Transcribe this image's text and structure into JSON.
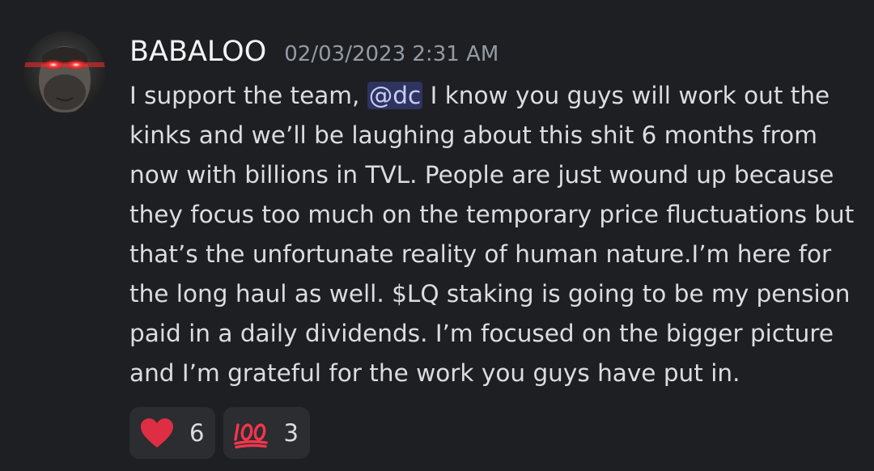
{
  "message": {
    "author": "BABALOO",
    "timestamp": "02/03/2023 2:31 AM",
    "text_before_mention": "I support the team, ",
    "mention": "@dc",
    "text_after_mention": " I know you guys will work out the kinks and we’ll be laughing about this shit 6 months from now with billions in TVL. People are just wound up because they focus too much on the temporary price fluctuations but that’s the unfortunate reality of human nature.I’m here for the long haul as well. $LQ staking is going to be my pension paid in a daily dividends. I’m focused on the bigger picture and I’m grateful for the work you guys have put in."
  },
  "reactions": [
    {
      "emoji": "heart-icon",
      "count": "6"
    },
    {
      "emoji": "hundred-points-icon",
      "count": "3"
    }
  ],
  "colors": {
    "background": "#1e1f22",
    "text": "#dbdee1",
    "username": "#f2f3f5",
    "timestamp": "#949ba4",
    "mention_bg": "#3c4270",
    "reaction_bg": "#2b2d31",
    "heart": "#dd2e44"
  }
}
